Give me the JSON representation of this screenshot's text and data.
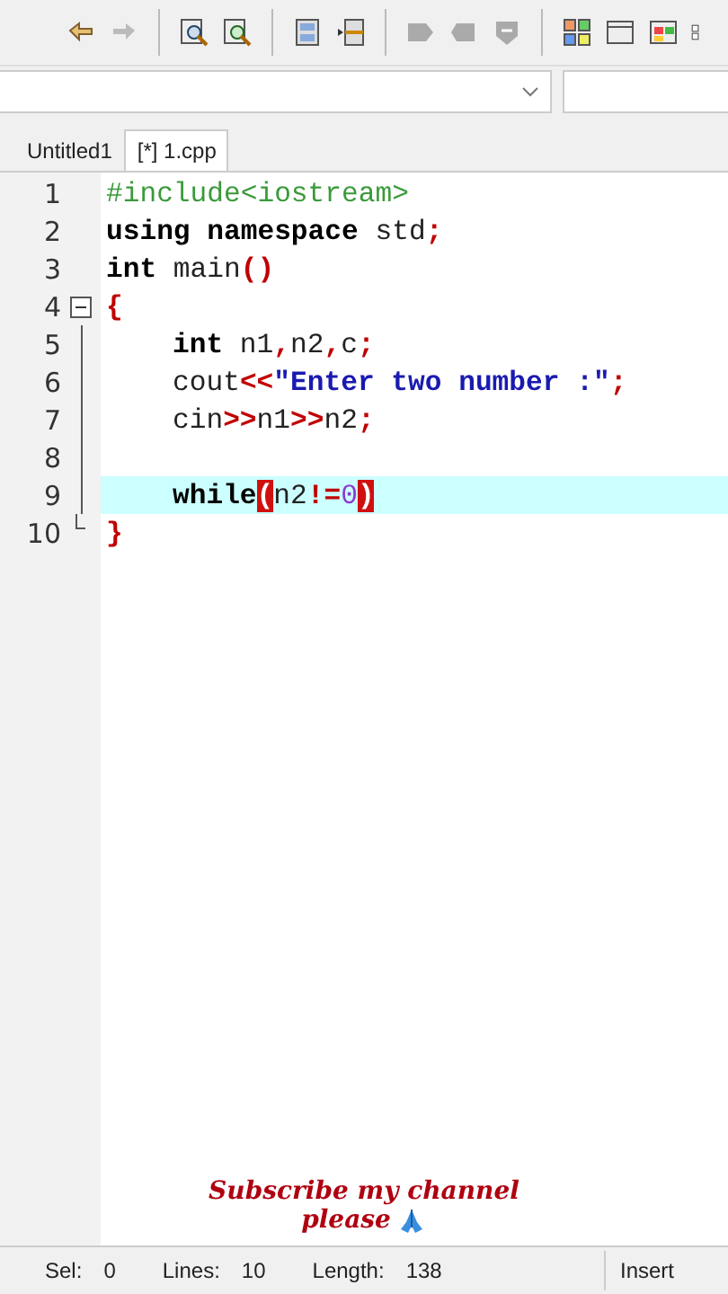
{
  "tabs": [
    {
      "label": "Untitled1",
      "selected": false
    },
    {
      "label": "[*] 1.cpp",
      "selected": true
    }
  ],
  "editor": {
    "lines": [
      {
        "number": "1",
        "current": false,
        "indent": false,
        "tokens": [
          {
            "kind": "preprocessor",
            "text": "#include<iostream>"
          }
        ]
      },
      {
        "number": "2",
        "current": false,
        "indent": false,
        "tokens": [
          {
            "kind": "keyword",
            "text": "using namespace"
          },
          {
            "kind": "plain",
            "text": " std"
          },
          {
            "kind": "operator",
            "text": ";"
          }
        ]
      },
      {
        "number": "3",
        "current": false,
        "indent": false,
        "tokens": [
          {
            "kind": "keyword",
            "text": "int"
          },
          {
            "kind": "plain",
            "text": " main"
          },
          {
            "kind": "operator",
            "text": "()"
          }
        ]
      },
      {
        "number": "4",
        "current": false,
        "indent": false,
        "kind": "fold-start",
        "tokens": [
          {
            "kind": "operator",
            "text": "{"
          }
        ]
      },
      {
        "number": "5",
        "current": false,
        "indent": true,
        "tokens": [
          {
            "kind": "keyword",
            "text": "int"
          },
          {
            "kind": "plain",
            "text": " n1"
          },
          {
            "kind": "operator",
            "text": ","
          },
          {
            "kind": "plain",
            "text": "n2"
          },
          {
            "kind": "operator",
            "text": ","
          },
          {
            "kind": "plain",
            "text": "c"
          },
          {
            "kind": "operator",
            "text": ";"
          }
        ]
      },
      {
        "number": "6",
        "current": false,
        "indent": true,
        "tokens": [
          {
            "kind": "plain",
            "text": "cout"
          },
          {
            "kind": "operator",
            "text": "<<"
          },
          {
            "kind": "string",
            "text": "\"Enter two number :\""
          },
          {
            "kind": "operator",
            "text": ";"
          }
        ]
      },
      {
        "number": "7",
        "current": false,
        "indent": true,
        "tokens": [
          {
            "kind": "plain",
            "text": "cin"
          },
          {
            "kind": "operator",
            "text": ">>"
          },
          {
            "kind": "plain",
            "text": "n1"
          },
          {
            "kind": "operator",
            "text": ">>"
          },
          {
            "kind": "plain",
            "text": "n2"
          },
          {
            "kind": "operator",
            "text": ";"
          }
        ]
      },
      {
        "number": "8",
        "current": false
      },
      {
        "number": "9",
        "current": true,
        "indent": true,
        "tokens": [
          {
            "kind": "keyword",
            "text": "while"
          },
          {
            "kind": "bracket",
            "text": "("
          },
          {
            "kind": "plain",
            "text": "n2"
          },
          {
            "kind": "operator",
            "text": "!="
          },
          {
            "kind": "number",
            "text": "0"
          },
          {
            "kind": "bracket",
            "text": ")"
          }
        ]
      },
      {
        "number": "10",
        "current": false,
        "indent": false,
        "kind": "fold-end",
        "tokens": [
          {
            "kind": "operator",
            "text": "}"
          }
        ]
      }
    ]
  },
  "caption": {
    "line_1": "Subscribe my channel",
    "line_2": "please"
  },
  "status_bar": [
    {
      "label": "Sel:",
      "value": "0"
    },
    {
      "label": "Lines:",
      "value": "10"
    },
    {
      "label": "Length:",
      "value": "138"
    },
    {
      "label": "Insert"
    }
  ]
}
